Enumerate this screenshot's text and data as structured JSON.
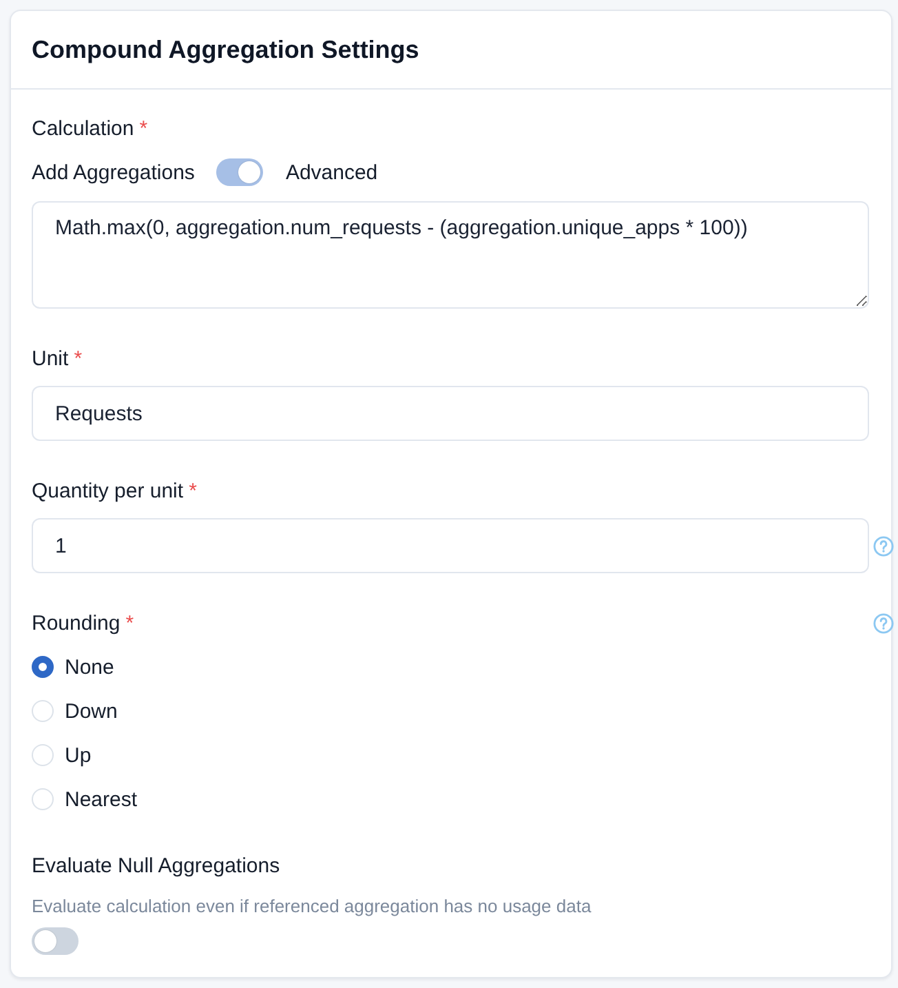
{
  "panel": {
    "title": "Compound Aggregation Settings"
  },
  "calculation": {
    "label": "Calculation",
    "required_mark": "*",
    "mode_switch": {
      "left_label": "Add Aggregations",
      "right_label": "Advanced",
      "on": true
    },
    "value": "Math.max(0, aggregation.num_requests - (aggregation.unique_apps * 100))"
  },
  "unit": {
    "label": "Unit",
    "required_mark": "*",
    "value": "Requests"
  },
  "quantity_per_unit": {
    "label": "Quantity per unit",
    "required_mark": "*",
    "value": "1",
    "help": true
  },
  "rounding": {
    "label": "Rounding",
    "required_mark": "*",
    "help": true,
    "options": [
      {
        "label": "None",
        "selected": true
      },
      {
        "label": "Down",
        "selected": false
      },
      {
        "label": "Up",
        "selected": false
      },
      {
        "label": "Nearest",
        "selected": false
      }
    ]
  },
  "evaluate_null": {
    "label": "Evaluate Null Aggregations",
    "description": "Evaluate calculation even if referenced aggregation has no usage data",
    "on": false
  }
}
